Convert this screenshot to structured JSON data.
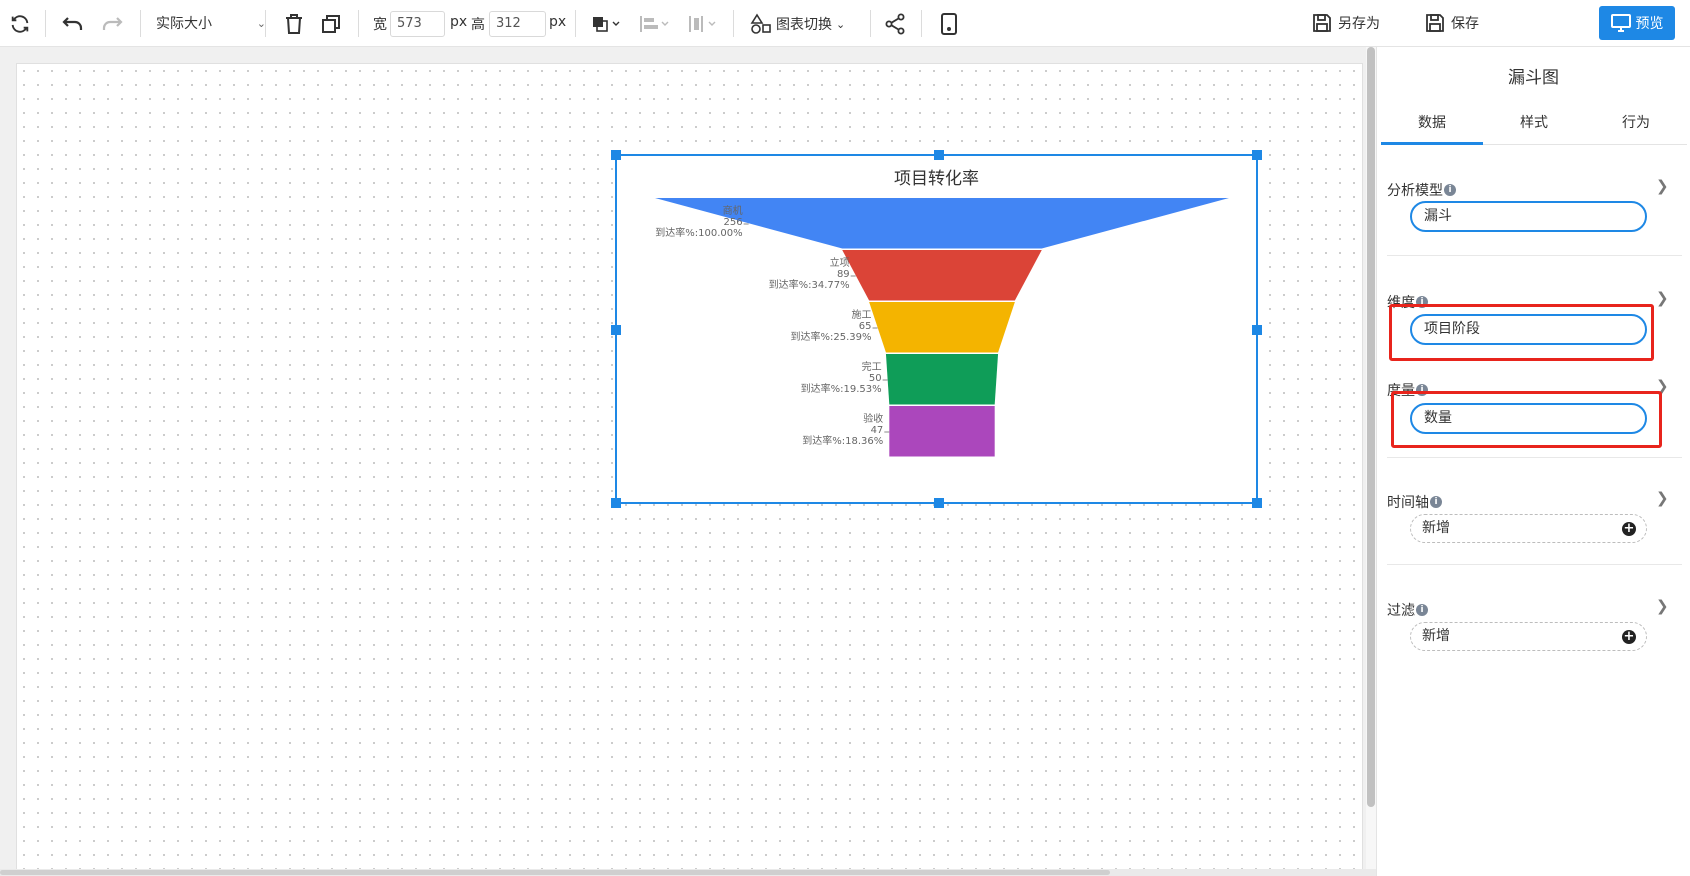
{
  "toolbar": {
    "zoom": "实际大小",
    "width_label": "宽",
    "width_value": "573",
    "height_label": "高",
    "height_value": "312",
    "px_unit": "px",
    "chart_switch": "图表切换",
    "save_as": "另存为",
    "save": "保存",
    "preview": "预览"
  },
  "widget": {
    "title": "项目转化率"
  },
  "chart_data": {
    "type": "funnel",
    "title": "项目转化率",
    "categories": [
      "商机",
      "立项",
      "施工",
      "完工",
      "验收"
    ],
    "values": [
      256,
      89,
      65,
      50,
      47
    ],
    "rate_prefix": "到达率%:",
    "rates": [
      "100.00%",
      "34.77%",
      "25.39%",
      "19.53%",
      "18.36%"
    ],
    "colors": [
      "#4285f4",
      "#db4437",
      "#f4b400",
      "#0f9d58",
      "#ab47bc"
    ]
  },
  "panel": {
    "title": "漏斗图",
    "tabs": [
      "数据",
      "样式",
      "行为"
    ],
    "sections": {
      "model": {
        "label": "分析模型",
        "value": "漏斗"
      },
      "dimension": {
        "label": "维度",
        "value": "项目阶段"
      },
      "measure": {
        "label": "度量",
        "value": "数量"
      },
      "timeline": {
        "label": "时间轴",
        "value": "新增"
      },
      "filter": {
        "label": "过滤",
        "value": "新增"
      }
    }
  },
  "colors": {
    "accent": "#1e88e5",
    "highlight": "#e8241c"
  }
}
